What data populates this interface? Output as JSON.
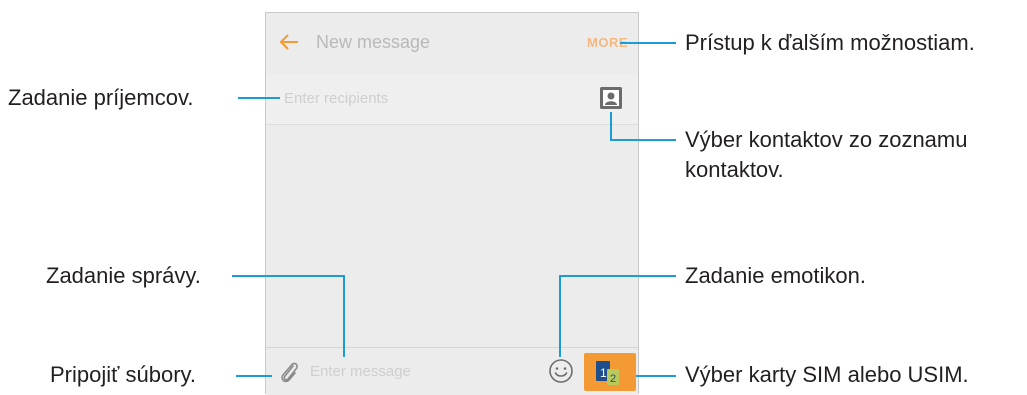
{
  "screen": {
    "title": "New message",
    "more_label": "MORE",
    "recipients_placeholder": "Enter recipients",
    "message_placeholder": "Enter message",
    "sim_label": "1",
    "sim_sub": "2"
  },
  "callouts": {
    "recipients": "Zadanie príjemcov.",
    "more": "Prístup k ďalším možnostiam.",
    "contacts_line1": "Výber kontaktov zo zoznamu",
    "contacts_line2": "kontaktov.",
    "message": "Zadanie správy.",
    "emoticon": "Zadanie emotikon.",
    "attach": "Pripojiť súbory.",
    "sim": "Výber karty SIM alebo USIM."
  },
  "colors": {
    "accent_line": "#1b9bd7",
    "sim_button": "#f39a34",
    "back_arrow": "#f39a34"
  },
  "icons": [
    "back-arrow-icon",
    "contact-icon",
    "paperclip-icon",
    "smiley-icon",
    "sim-card-icon"
  ]
}
